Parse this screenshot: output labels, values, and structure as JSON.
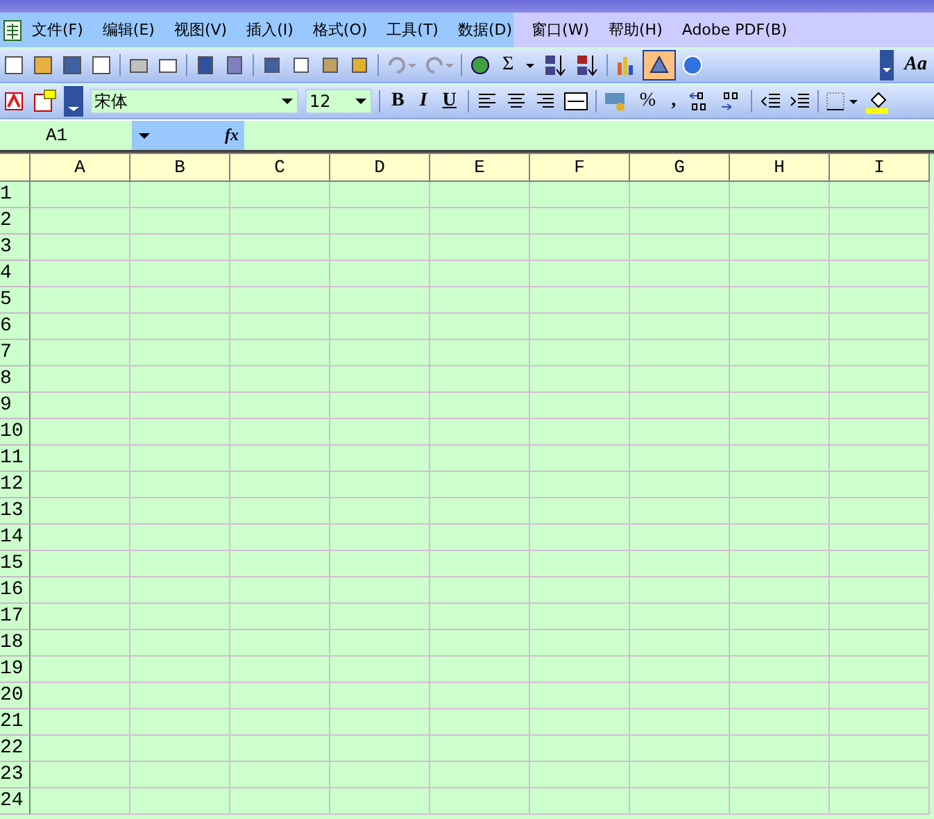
{
  "menu": [
    {
      "label": "文件(F)"
    },
    {
      "label": "编辑(E)"
    },
    {
      "label": "视图(V)"
    },
    {
      "label": "插入(I)"
    },
    {
      "label": "格式(O)"
    },
    {
      "label": "工具(T)"
    },
    {
      "label": "数据(D)"
    },
    {
      "label": "窗口(W)"
    },
    {
      "label": "帮助(H)"
    },
    {
      "label": "Adobe PDF(B)"
    }
  ],
  "toolbar_1": {
    "sum": "Σ",
    "style": "Aa",
    "drawing_pressed": true
  },
  "toolbar_2": {
    "font": "宋体",
    "size": "12",
    "bold": "B",
    "italic": "I",
    "underline": "U",
    "percent": "%",
    "comma": ","
  },
  "formula_bar": {
    "name_box": "A1",
    "fx": "fx"
  },
  "columns": [
    "A",
    "B",
    "C",
    "D",
    "E",
    "F",
    "G",
    "H",
    "I"
  ],
  "rows": [
    "1",
    "2",
    "3",
    "4",
    "5",
    "6",
    "7",
    "8",
    "9",
    "10",
    "11",
    "12",
    "13",
    "14",
    "15",
    "16",
    "17",
    "18",
    "19",
    "20",
    "21",
    "22",
    "23",
    "24"
  ]
}
